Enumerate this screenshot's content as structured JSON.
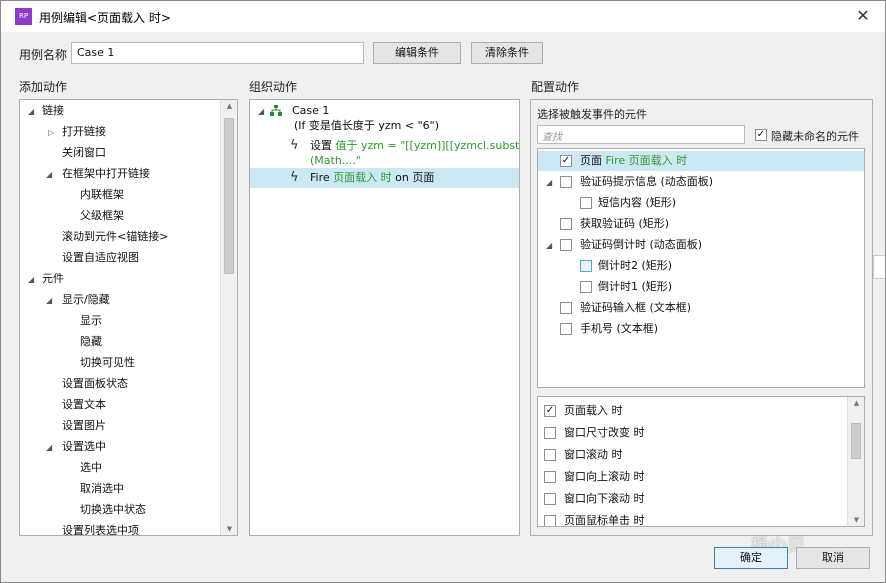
{
  "window": {
    "title": "用例编辑<页面载入 时>",
    "app_icon_text": "RP"
  },
  "header": {
    "case_name_label": "用例名称",
    "case_name_value": "Case 1",
    "edit_condition_label": "编辑条件",
    "clear_condition_label": "清除条件"
  },
  "add_actions": {
    "heading": "添加动作",
    "items": [
      {
        "label": "链接"
      },
      {
        "label": "打开链接"
      },
      {
        "label": "关闭窗口"
      },
      {
        "label": "在框架中打开链接"
      },
      {
        "label": "内联框架"
      },
      {
        "label": "父级框架"
      },
      {
        "label": "滚动到元件<锚链接>"
      },
      {
        "label": "设置自适应视图"
      },
      {
        "label": "元件"
      },
      {
        "label": "显示/隐藏"
      },
      {
        "label": "显示"
      },
      {
        "label": "隐藏"
      },
      {
        "label": "切换可见性"
      },
      {
        "label": "设置面板状态"
      },
      {
        "label": "设置文本"
      },
      {
        "label": "设置图片"
      },
      {
        "label": "设置选中"
      },
      {
        "label": "选中"
      },
      {
        "label": "取消选中"
      },
      {
        "label": "切换选中状态"
      },
      {
        "label": "设置列表选中项"
      }
    ]
  },
  "organize": {
    "heading": "组织动作",
    "case_title": "Case 1",
    "case_condition": "(If 变是值长度于 yzm < \"6\")",
    "action1_prefix": "设置",
    "action1_green_line1": "值于 yzm = \"[[yzm]][[yzmcl.substr",
    "action1_green_line2": "(Math....\"",
    "action2_prefix": "Fire",
    "action2_green": "页面载入 时",
    "action2_suffix": "on 页面"
  },
  "config": {
    "heading": "配置动作",
    "subheading": "选择被触发事件的元件",
    "search_placeholder": "查找",
    "hide_unnamed_label": "隐藏未命名的元件",
    "hide_unnamed_checked": true,
    "targets": [
      {
        "label": "页面",
        "green": "Fire 页面载入 时",
        "checked": true
      },
      {
        "label": "验证码提示信息 (动态面板)",
        "checked": false
      },
      {
        "label": "短信内容 (矩形)",
        "checked": false
      },
      {
        "label": "获取验证码 (矩形)",
        "checked": false
      },
      {
        "label": "验证码倒计时 (动态面板)",
        "checked": false
      },
      {
        "label": "倒计时2 (矩形)",
        "checked": false
      },
      {
        "label": "倒计时1 (矩形)",
        "checked": false
      },
      {
        "label": "验证码输入框 (文本框)",
        "checked": false
      },
      {
        "label": "手机号 (文本框)",
        "checked": false
      }
    ],
    "events": [
      {
        "label": "页面载入 时",
        "checked": true
      },
      {
        "label": "窗口尺寸改变 时",
        "checked": false
      },
      {
        "label": "窗口滚动 时",
        "checked": false
      },
      {
        "label": "窗口向上滚动 时",
        "checked": false
      },
      {
        "label": "窗口向下滚动 时",
        "checked": false
      },
      {
        "label": "页面鼠标单击 时",
        "checked": false
      }
    ]
  },
  "footer": {
    "ok_label": "确定",
    "cancel_label": "取消",
    "watermark": "杨小贝"
  }
}
